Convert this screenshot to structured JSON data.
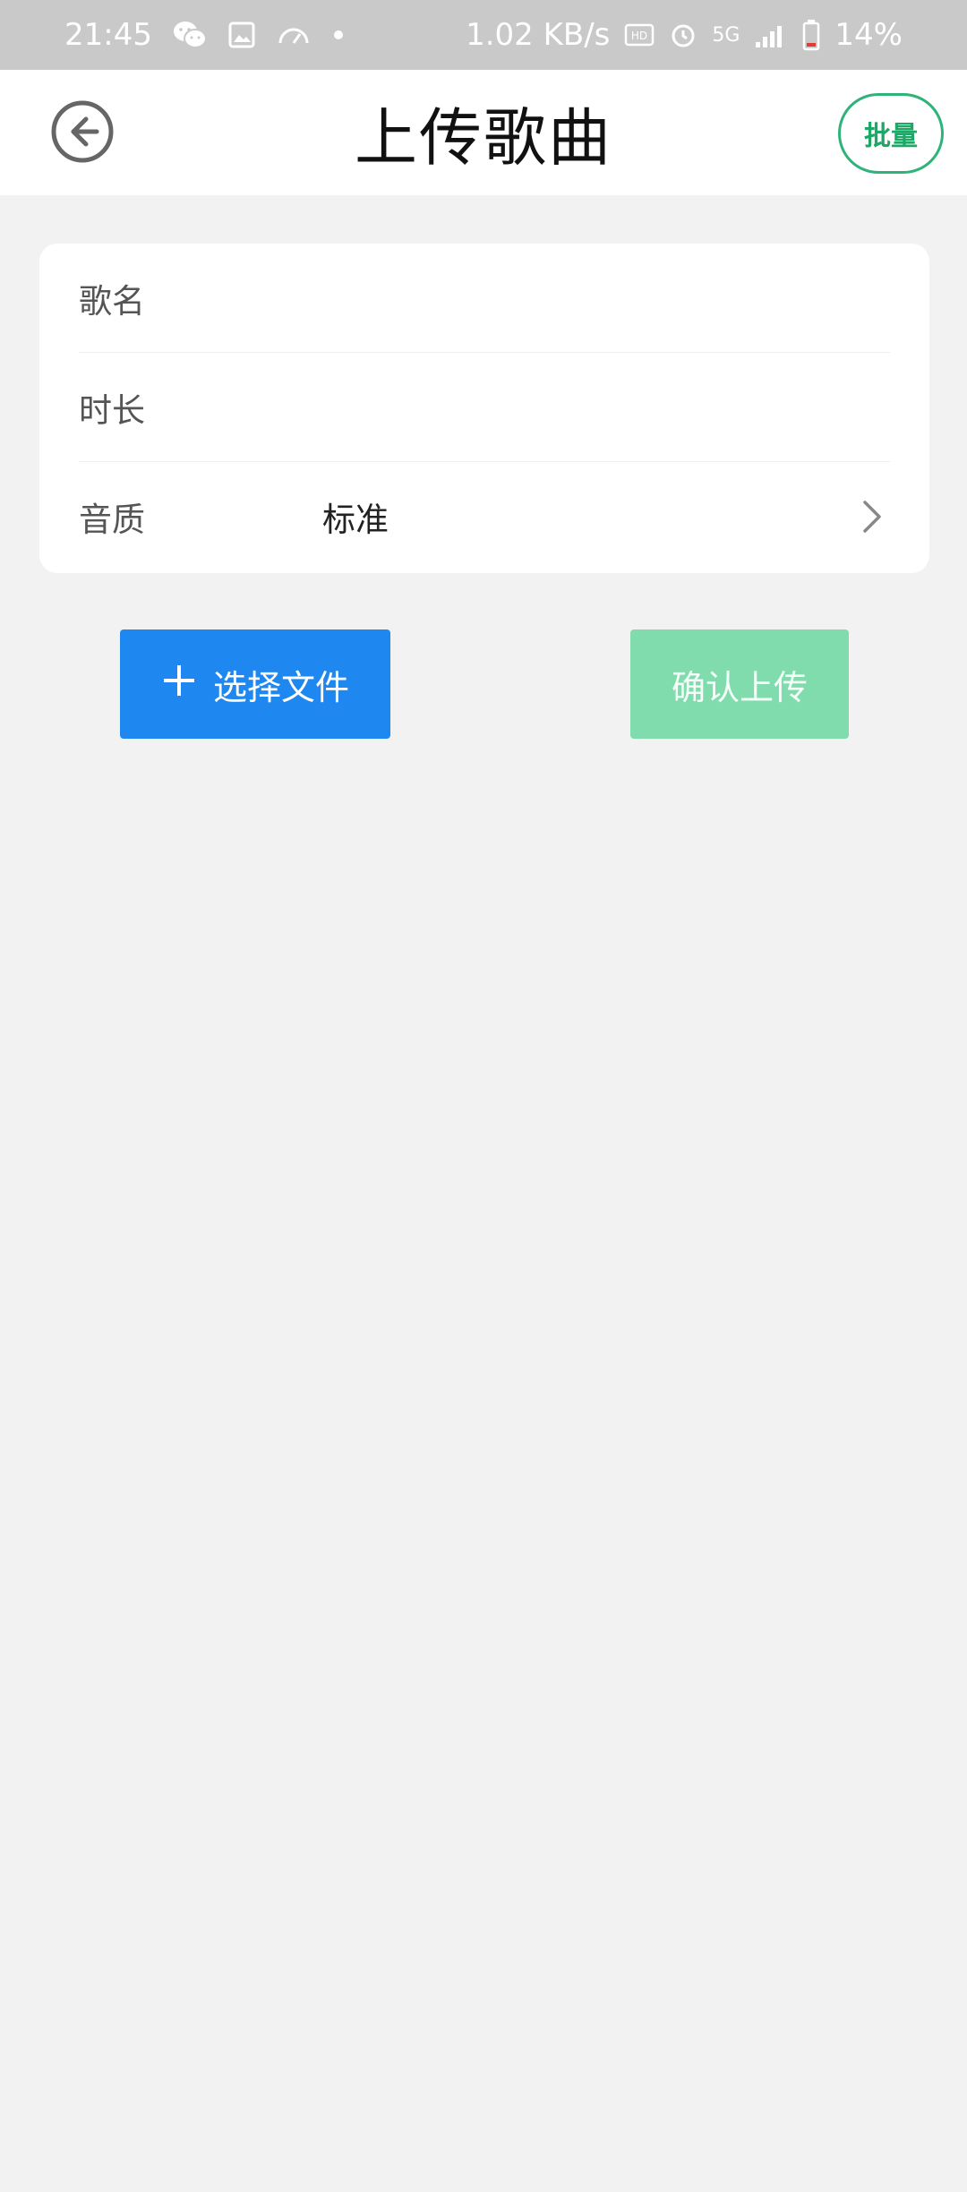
{
  "status_bar": {
    "time": "21:45",
    "net_speed": "1.02 KB/s",
    "battery": "14%",
    "network": "5G",
    "icons": [
      "wechat-icon",
      "gallery-icon",
      "speedometer-icon",
      "dot-icon",
      "hd-icon",
      "alarm-icon",
      "signal-icon",
      "battery-icon"
    ]
  },
  "header": {
    "title": "上传歌曲",
    "batch_label": "批量"
  },
  "form": {
    "song_name": {
      "label": "歌名",
      "value": ""
    },
    "duration": {
      "label": "时长",
      "value": ""
    },
    "quality": {
      "label": "音质",
      "value": "标准"
    }
  },
  "actions": {
    "select_file": "选择文件",
    "confirm_upload": "确认上传"
  },
  "colors": {
    "primary_blue": "#1e88f0",
    "green": "#80dbad",
    "accent_green": "#2fb37a"
  }
}
